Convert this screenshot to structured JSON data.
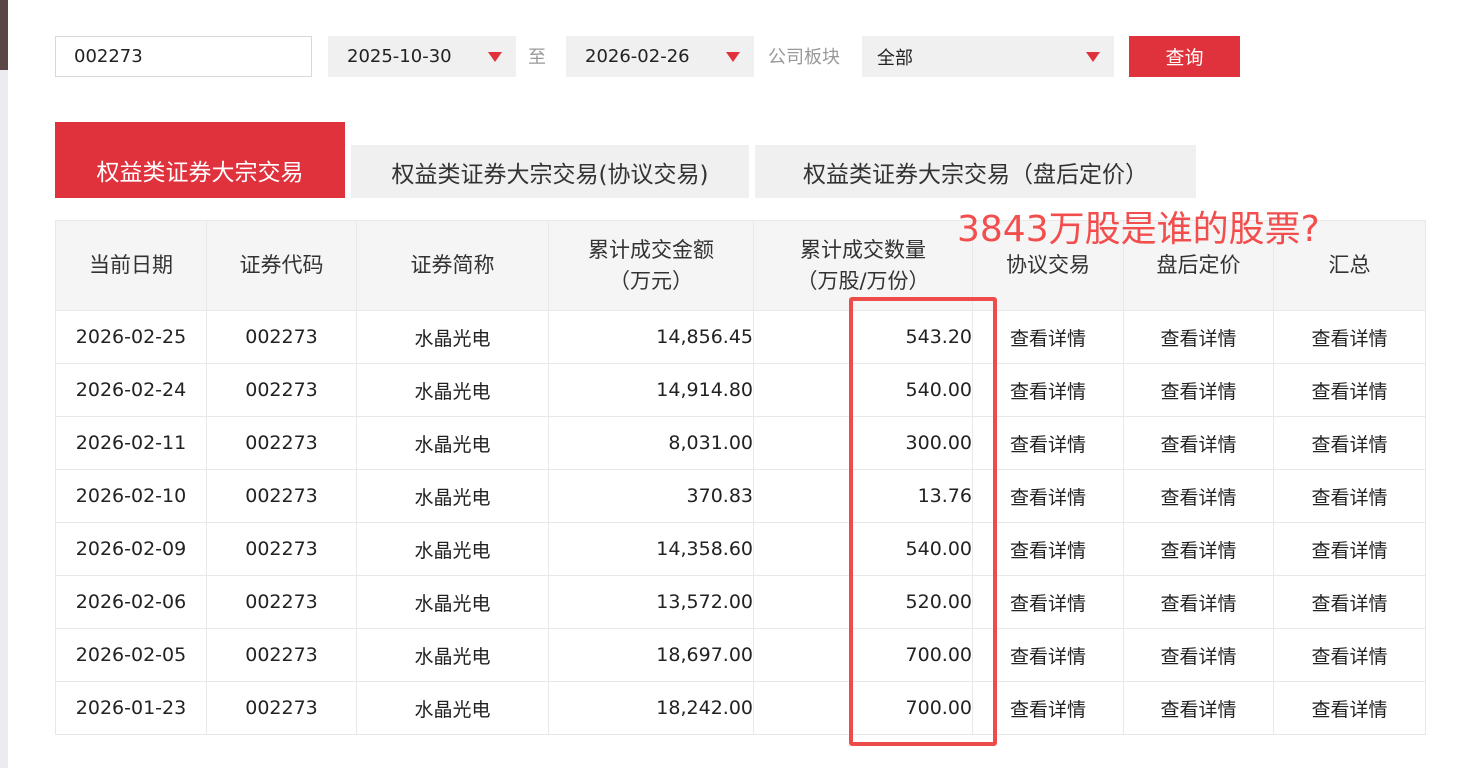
{
  "filters": {
    "stock_code": "002273",
    "start_date": "2025-10-30",
    "to_label": "至",
    "end_date": "2026-02-26",
    "board_label": "公司板块",
    "board_value": "全部",
    "query_button": "查询"
  },
  "tabs": [
    {
      "label": "权益类证券大宗交易",
      "active": true
    },
    {
      "label": "权益类证券大宗交易(协议交易)",
      "active": false
    },
    {
      "label": "权益类证券大宗交易（盘后定价）",
      "active": false
    }
  ],
  "table": {
    "headers": {
      "date": "当前日期",
      "code": "证券代码",
      "name": "证券简称",
      "amount_line1": "累计成交金额",
      "amount_line2": "（万元）",
      "volume_line1": "累计成交数量",
      "volume_line2": "（万股/万份）",
      "protocol": "协议交易",
      "after_hours": "盘后定价",
      "summary": "汇总"
    },
    "rows": [
      {
        "date": "2026-02-25",
        "code": "002273",
        "name": "水晶光电",
        "amount": "14,856.45",
        "volume": "543.20",
        "protocol": "查看详情",
        "after_hours": "查看详情",
        "summary": "查看详情"
      },
      {
        "date": "2026-02-24",
        "code": "002273",
        "name": "水晶光电",
        "amount": "14,914.80",
        "volume": "540.00",
        "protocol": "查看详情",
        "after_hours": "查看详情",
        "summary": "查看详情"
      },
      {
        "date": "2026-02-11",
        "code": "002273",
        "name": "水晶光电",
        "amount": "8,031.00",
        "volume": "300.00",
        "protocol": "查看详情",
        "after_hours": "查看详情",
        "summary": "查看详情"
      },
      {
        "date": "2026-02-10",
        "code": "002273",
        "name": "水晶光电",
        "amount": "370.83",
        "volume": "13.76",
        "protocol": "查看详情",
        "after_hours": "查看详情",
        "summary": "查看详情"
      },
      {
        "date": "2026-02-09",
        "code": "002273",
        "name": "水晶光电",
        "amount": "14,358.60",
        "volume": "540.00",
        "protocol": "查看详情",
        "after_hours": "查看详情",
        "summary": "查看详情"
      },
      {
        "date": "2026-02-06",
        "code": "002273",
        "name": "水晶光电",
        "amount": "13,572.00",
        "volume": "520.00",
        "protocol": "查看详情",
        "after_hours": "查看详情",
        "summary": "查看详情"
      },
      {
        "date": "2026-02-05",
        "code": "002273",
        "name": "水晶光电",
        "amount": "18,697.00",
        "volume": "700.00",
        "protocol": "查看详情",
        "after_hours": "查看详情",
        "summary": "查看详情"
      },
      {
        "date": "2026-01-23",
        "code": "002273",
        "name": "水晶光电",
        "amount": "18,242.00",
        "volume": "700.00",
        "protocol": "查看详情",
        "after_hours": "查看详情",
        "summary": "查看详情"
      }
    ]
  },
  "annotation": {
    "text": "3843万股是谁的股票?",
    "color": "#ee4b4b"
  },
  "colors": {
    "accent": "#e0323c",
    "link": "#2a6fc4"
  },
  "icons": {
    "dropdown": "caret-down-icon"
  }
}
